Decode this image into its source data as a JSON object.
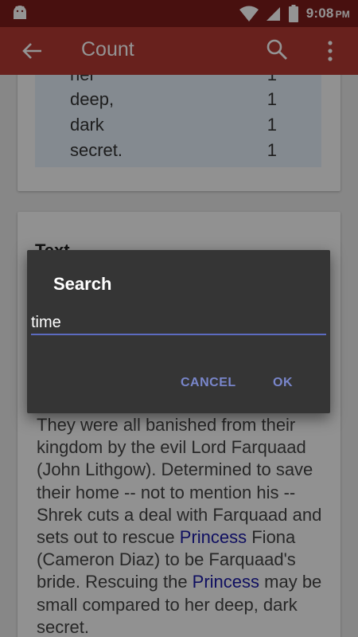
{
  "status_bar": {
    "time": "9:08",
    "ampm": "PM",
    "icons": [
      "android-icon",
      "wifi-icon",
      "signal-icon",
      "battery-icon"
    ]
  },
  "app_bar": {
    "title": "Count",
    "icons": [
      "back-arrow-icon",
      "search-icon",
      "more-vert-icon"
    ]
  },
  "word_counts": [
    {
      "word": "her",
      "count": "1"
    },
    {
      "word": "deep,",
      "count": "1"
    },
    {
      "word": "dark",
      "count": "1"
    },
    {
      "word": "secret.",
      "count": "1"
    }
  ],
  "text_card": {
    "heading": "Text",
    "paragraph": [
      {
        "text": "They were all banished from their kingdom by the evil Lord Farquaad (John Lithgow). Determined to save their home -- not to mention his -- Shrek cuts a deal with Farquaad and sets out to rescue ",
        "highlight": false
      },
      {
        "text": "Princess",
        "highlight": true
      },
      {
        "text": " Fiona (Cameron Diaz) to be Farquaad's bride. Rescuing the ",
        "highlight": false
      },
      {
        "text": "Princess",
        "highlight": true
      },
      {
        "text": " may be small compared to her deep, dark secret.",
        "highlight": false
      }
    ]
  },
  "dialog": {
    "title": "Search",
    "input_value": "time",
    "cancel_label": "CANCEL",
    "ok_label": "OK"
  },
  "colors": {
    "status_bar": "#7d1d1a",
    "app_bar": "#b33a33",
    "highlight": "#1a1aa6",
    "dialog_bg": "#353535",
    "accent": "#5c6bc0"
  }
}
